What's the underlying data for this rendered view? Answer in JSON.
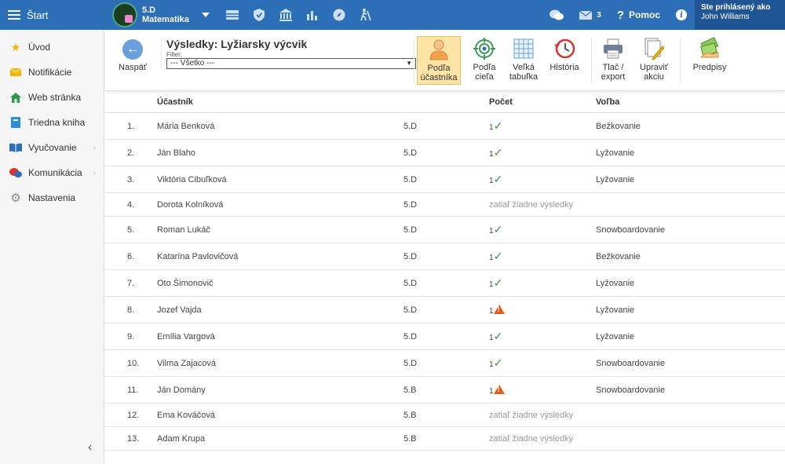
{
  "topbar": {
    "start_label": "Štart",
    "class_line1": "5.D",
    "class_line2": "Matematika",
    "messages_count": "3",
    "help_label": "Pomoc",
    "user_label": "Ste prihlásený ako",
    "user_name": "John Williams",
    "color": "#2c6fb6"
  },
  "sidebar": {
    "items": [
      {
        "label": "Úvod",
        "icon": "star-icon"
      },
      {
        "label": "Notifikácie",
        "icon": "envelope-icon"
      },
      {
        "label": "Web stránka",
        "icon": "home-icon"
      },
      {
        "label": "Triedna kniha",
        "icon": "book-icon"
      },
      {
        "label": "Vyučovanie",
        "icon": "open-book-icon"
      },
      {
        "label": "Komunikácia",
        "icon": "chat-icon"
      },
      {
        "label": "Nastavenia",
        "icon": "gear-icon"
      }
    ]
  },
  "toolbar": {
    "back_label": "Naspäť",
    "title": "Výsledky: Lyžiarsky výcvik",
    "filter_label": "Filter:",
    "filter_value": "--- Všetko ---",
    "buttons": [
      {
        "line1": "Podľa",
        "line2": "účastníka"
      },
      {
        "line1": "Podľa",
        "line2": "cieľa"
      },
      {
        "line1": "Veľká",
        "line2": "tabuľka"
      },
      {
        "line1": "História",
        "line2": ""
      },
      {
        "line1": "Tlač /",
        "line2": "export"
      },
      {
        "line1": "Upraviť",
        "line2": "akciu"
      },
      {
        "line1": "Predpisy",
        "line2": ""
      }
    ]
  },
  "table": {
    "headers": {
      "name": "Účastník",
      "count": "Počet",
      "choice": "Voľba"
    },
    "no_results": "zatiaľ žiadne výsledky",
    "rows": [
      {
        "num": "1.",
        "name": "Mária Benková",
        "class": "5.D",
        "count": "1",
        "status": "ok",
        "choice": "Bežkovanie"
      },
      {
        "num": "2.",
        "name": "Ján Blaho",
        "class": "5.D",
        "count": "1",
        "status": "ok",
        "choice": "Lyžovanie"
      },
      {
        "num": "3.",
        "name": "Viktória Cibuľková",
        "class": "5.D",
        "count": "1",
        "status": "ok",
        "choice": "Lyžovanie"
      },
      {
        "num": "4.",
        "name": "Dorota Kolníková",
        "class": "5.D",
        "count": "",
        "status": "none",
        "choice": ""
      },
      {
        "num": "5.",
        "name": "Roman Lukáč",
        "class": "5.D",
        "count": "1",
        "status": "ok",
        "choice": "Snowboardovanie"
      },
      {
        "num": "6.",
        "name": "Katarína Pavlovičová",
        "class": "5.D",
        "count": "1",
        "status": "ok",
        "choice": "Bežkovanie"
      },
      {
        "num": "7.",
        "name": "Oto Šimonovič",
        "class": "5.D",
        "count": "1",
        "status": "ok",
        "choice": "Lyžovanie"
      },
      {
        "num": "8.",
        "name": "Jozef Vajda",
        "class": "5.D",
        "count": "1",
        "status": "warn",
        "choice": "Lyžovanie"
      },
      {
        "num": "9.",
        "name": "Emília Vargová",
        "class": "5.D",
        "count": "1",
        "status": "ok",
        "choice": "Lyžovanie"
      },
      {
        "num": "10.",
        "name": "Vilma Zajacová",
        "class": "5.D",
        "count": "1",
        "status": "ok",
        "choice": "Snowboardovanie"
      },
      {
        "num": "11.",
        "name": "Ján Domány",
        "class": "5.B",
        "count": "1",
        "status": "warn",
        "choice": "Snowboardovanie"
      },
      {
        "num": "12.",
        "name": "Ema Kováčová",
        "class": "5.B",
        "count": "",
        "status": "none",
        "choice": ""
      },
      {
        "num": "13.",
        "name": "Adam Krupa",
        "class": "5.B",
        "count": "",
        "status": "none",
        "choice": ""
      }
    ]
  }
}
